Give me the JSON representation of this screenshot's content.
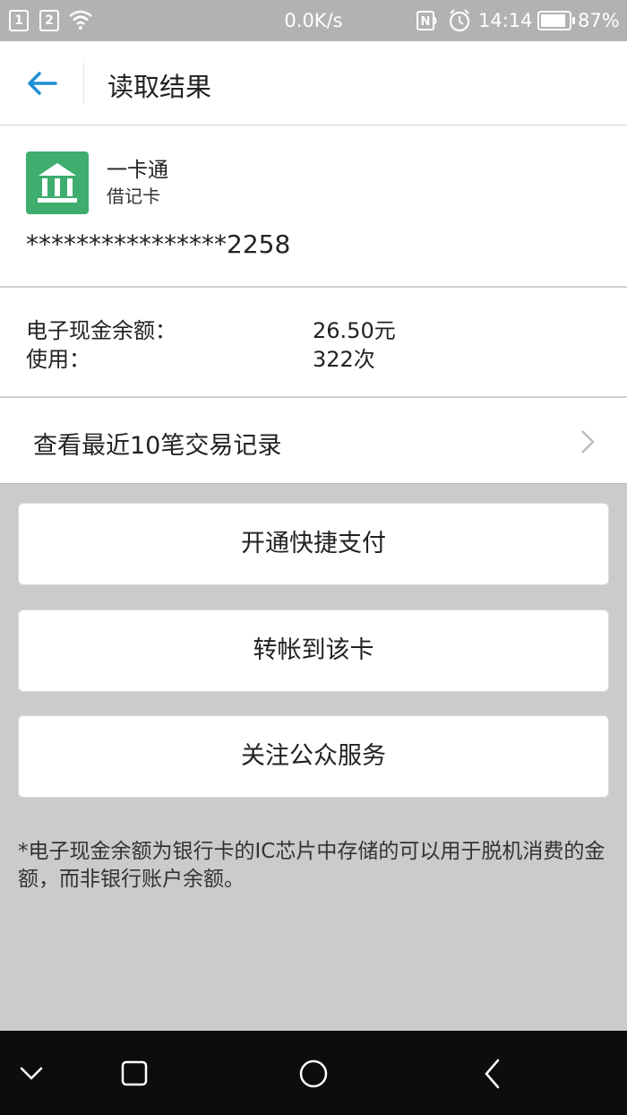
{
  "status_bar": {
    "sim1": "1",
    "sim2": "2",
    "speed": "0.0K/s",
    "nfc": "N",
    "time": "14:14",
    "battery": "87%",
    "battery_level": 0.87
  },
  "header": {
    "title": "读取结果"
  },
  "card": {
    "name": "一卡通",
    "type": "借记卡",
    "number": "****************2258",
    "logo_color": "#3ead6e"
  },
  "info": {
    "balance_label": "电子现金余额：",
    "balance_value": "26.50元",
    "usage_label": "使用：",
    "usage_value": "322次"
  },
  "transactions": {
    "label": "查看最近10笔交易记录"
  },
  "actions": {
    "quick_pay": "开通快捷支付",
    "transfer": "转帐到该卡",
    "follow": "关注公众服务"
  },
  "note": "*电子现金余额为银行卡的IC芯片中存储的可以用于脱机消费的金额，而非银行账户余额。",
  "colors": {
    "accent_blue": "#1a8fd6",
    "bank_green": "#3ead6e",
    "page_bg": "#cbcbcb"
  }
}
